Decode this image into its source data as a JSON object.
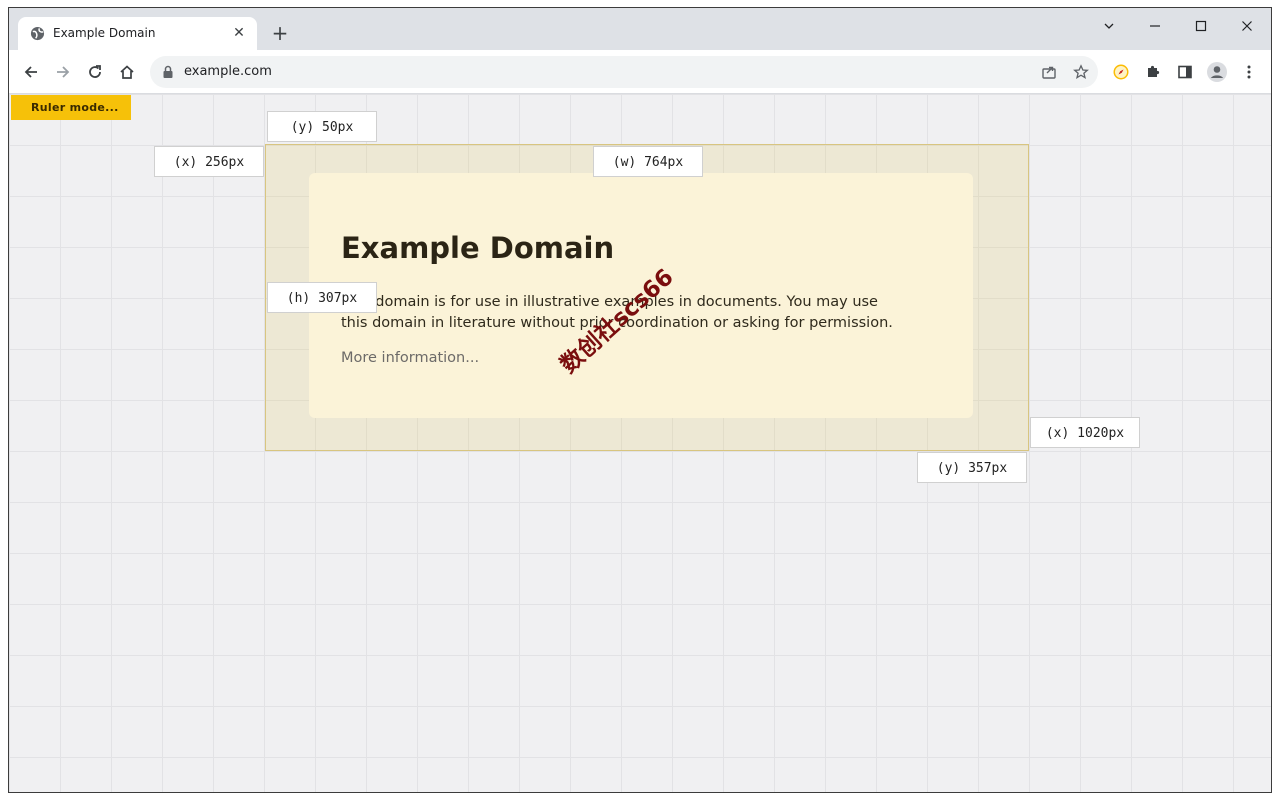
{
  "tab": {
    "title": "Example Domain"
  },
  "address": {
    "url": "example.com"
  },
  "ruler": {
    "label": "Ruler mode..."
  },
  "page": {
    "heading": "Example Domain",
    "body": "This domain is for use in illustrative examples in documents. You may use this domain in literature without prior coordination or asking for permission.",
    "link": "More information..."
  },
  "measurements": {
    "top_y": "(y) 50px",
    "left_x": "(x) 256px",
    "width": "(w) 764px",
    "height": "(h) 307px",
    "right_x": "(x) 1020px",
    "bottom_y": "(y) 357px"
  },
  "watermark": {
    "text": "数创社scs66"
  },
  "colors": {
    "ruler_accent": "#f6c109",
    "highlight_border": "#d8c580",
    "card_bg": "#fbf3d8"
  },
  "icons": {
    "favicon": "globe-icon",
    "close": "close-icon",
    "new_tab": "plus-icon",
    "back": "back-arrow-icon",
    "forward": "forward-arrow-icon",
    "reload": "reload-icon",
    "home": "home-icon",
    "lock": "lock-icon",
    "share": "share-icon",
    "bookmark": "star-icon",
    "extension1": "compass-extension-icon",
    "extensions": "puzzle-icon",
    "sidepanel": "side-panel-icon",
    "profile": "profile-icon",
    "menu": "kebab-menu-icon"
  }
}
